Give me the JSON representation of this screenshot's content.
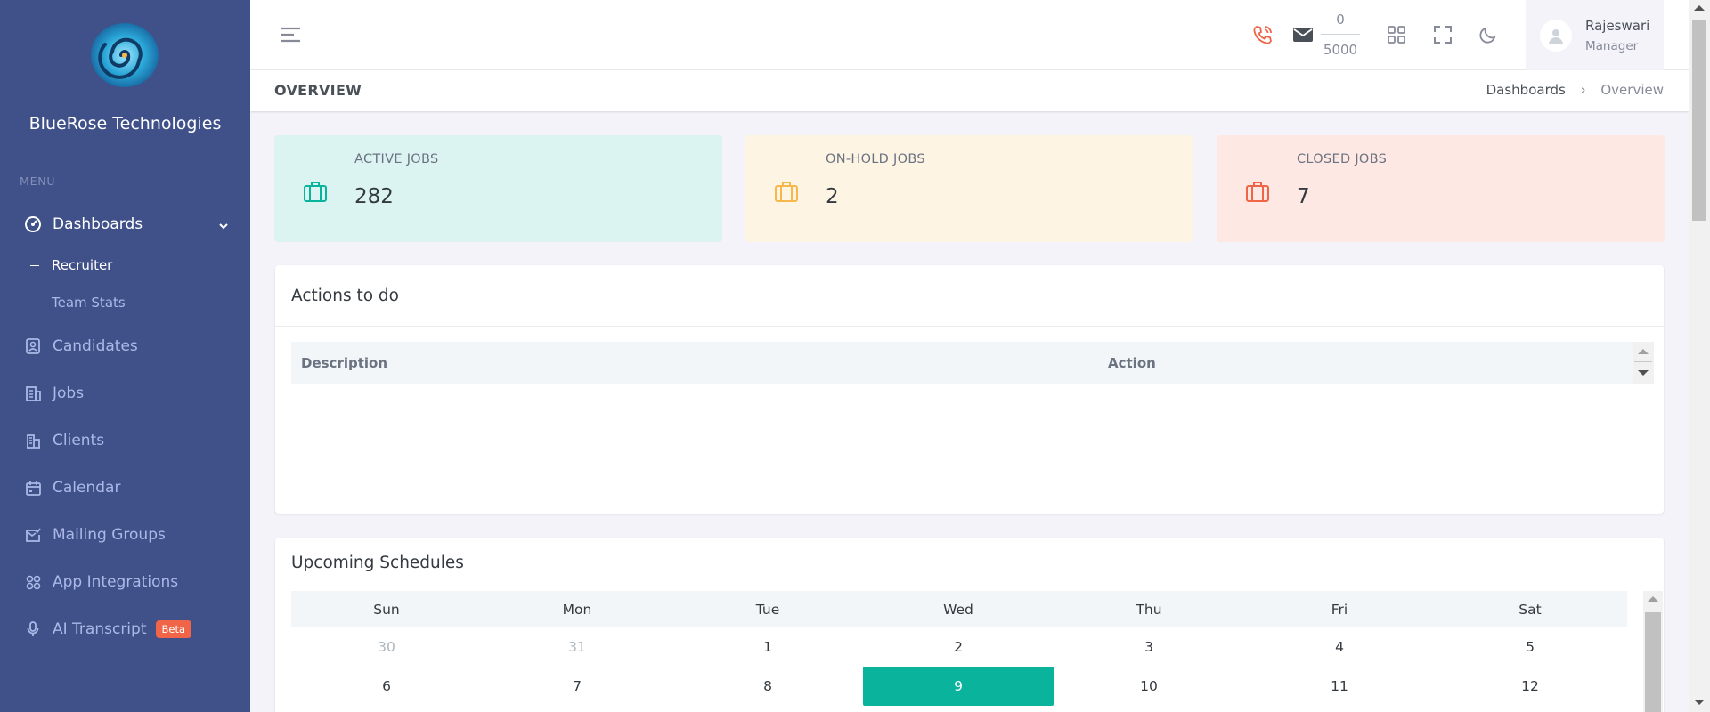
{
  "brand": {
    "name": "BlueRose Technologies",
    "logo_icon": "spiral-logo"
  },
  "colors": {
    "sidebar": "#405189",
    "accent_teal": "#0ab39c",
    "warning": "#f7b84b",
    "danger": "#f06548",
    "info_bg": "#dcf4f1",
    "warning_bg": "#fef4e4",
    "danger_bg": "#fde8e4"
  },
  "sidebar": {
    "menu_title": "MENU",
    "dashboards": {
      "label": "Dashboards",
      "icon": "dashboard-icon"
    },
    "sub_items": [
      {
        "label": "Recruiter"
      },
      {
        "label": "Team Stats"
      }
    ],
    "items": [
      {
        "label": "Candidates",
        "icon": "candidate-icon"
      },
      {
        "label": "Jobs",
        "icon": "jobs-icon"
      },
      {
        "label": "Clients",
        "icon": "building-icon"
      },
      {
        "label": "Calendar",
        "icon": "calendar-icon"
      },
      {
        "label": "Mailing Groups",
        "icon": "mail-check-icon"
      },
      {
        "label": "App Integrations",
        "icon": "apps-icon"
      },
      {
        "label": "AI Transcript",
        "icon": "mic-icon",
        "badge": "Beta"
      }
    ]
  },
  "topbar": {
    "counter": {
      "used": "0",
      "limit": "5000"
    },
    "user": {
      "name": "Rajeswari",
      "role": "Manager"
    }
  },
  "page": {
    "title": "OVERVIEW",
    "breadcrumb": {
      "parent": "Dashboards",
      "current": "Overview"
    }
  },
  "stats": [
    {
      "label": "ACTIVE JOBS",
      "value": "282"
    },
    {
      "label": "ON-HOLD JOBS",
      "value": "2"
    },
    {
      "label": "CLOSED JOBS",
      "value": "7"
    }
  ],
  "actions": {
    "title": "Actions to do",
    "columns": [
      "Description",
      "Action"
    ]
  },
  "schedules": {
    "title": "Upcoming Schedules",
    "weekdays": [
      "Sun",
      "Mon",
      "Tue",
      "Wed",
      "Thu",
      "Fri",
      "Sat"
    ],
    "weeks": [
      [
        "30",
        "31",
        "1",
        "2",
        "3",
        "4",
        "5"
      ],
      [
        "6",
        "7",
        "8",
        "9",
        "10",
        "11",
        "12"
      ]
    ],
    "today": "9"
  }
}
